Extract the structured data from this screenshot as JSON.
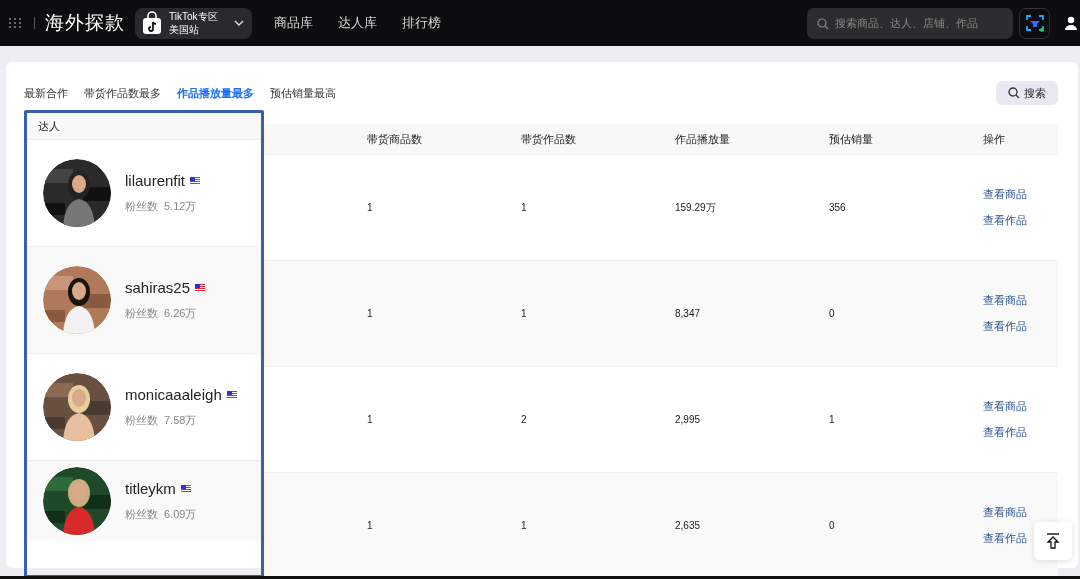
{
  "topbar": {
    "logo": "海外探款",
    "region": {
      "line1": "TikTok专区",
      "line2": "美国站"
    },
    "nav": [
      {
        "label": "商品库"
      },
      {
        "label": "达人库"
      },
      {
        "label": "排行榜"
      }
    ],
    "search": {
      "placeholder": "搜索商品、达人、店铺、作品"
    }
  },
  "tabs": [
    {
      "label": "最新合作",
      "selected": false
    },
    {
      "label": "带货作品数最多",
      "selected": false
    },
    {
      "label": "作品播放量最多",
      "selected": true
    },
    {
      "label": "预估销量最高",
      "selected": false
    }
  ],
  "search_button": "搜索",
  "table": {
    "columns": [
      "达人",
      "带货商品数",
      "带货作品数",
      "作品播放量",
      "预估销量",
      "操作"
    ],
    "rows": [
      {
        "name": "lilaurenfit",
        "followers_label": "粉丝数",
        "followers": "5.12万",
        "products": "1",
        "works": "1",
        "views": "159.29万",
        "sales": "356",
        "actions": [
          "查看商品",
          "查看作品"
        ]
      },
      {
        "name": "sahiras25",
        "followers_label": "粉丝数",
        "followers": "6.26万",
        "products": "1",
        "works": "1",
        "views": "8,347",
        "sales": "0",
        "actions": [
          "查看商品",
          "查看作品"
        ]
      },
      {
        "name": "monicaaaleigh",
        "followers_label": "粉丝数",
        "followers": "7.58万",
        "products": "1",
        "works": "2",
        "views": "2,995",
        "sales": "1",
        "actions": [
          "查看商品",
          "查看作品"
        ]
      },
      {
        "name": "titleykm",
        "followers_label": "粉丝数",
        "followers": "6.09万",
        "products": "1",
        "works": "1",
        "views": "2,635",
        "sales": "0",
        "actions": [
          "查看商品",
          "查看作品"
        ]
      }
    ]
  }
}
